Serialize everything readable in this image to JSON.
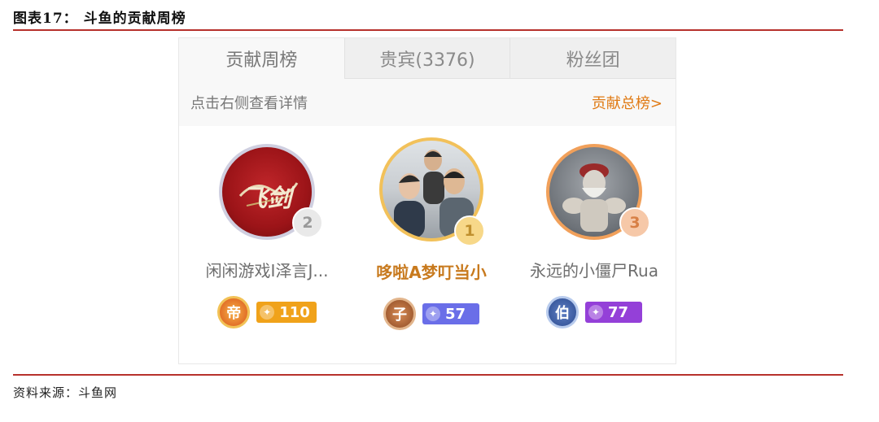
{
  "figure_title": "图表17： 斗鱼的贡献周榜",
  "source": "资料来源：斗鱼网",
  "tabs": [
    {
      "label": "贡献周榜",
      "active": true
    },
    {
      "label": "贵宾(3376)",
      "active": false
    },
    {
      "label": "粉丝团",
      "active": false
    }
  ],
  "infobar": {
    "hint": "点击右侧查看详情",
    "link": "贡献总榜>"
  },
  "ranking": [
    {
      "rank": "2",
      "name": "闲闲游戏I泽言J...",
      "avatar_text": "飞剑",
      "medal": "帝",
      "level": "110",
      "colors": {
        "ring": "#cfcfe0",
        "badge": "#b9b9b9",
        "level": "#f0a21a",
        "medal": "#e57b2a"
      }
    },
    {
      "rank": "1",
      "name": "哆啦A梦叮当小",
      "medal": "子",
      "level": "57",
      "colors": {
        "ring": "#f2c15a",
        "badge": "#f2c15a",
        "level": "#6a6ee8",
        "medal": "#b56b3a"
      }
    },
    {
      "rank": "3",
      "name": "永远的小僵尸Rua",
      "medal": "伯",
      "level": "77",
      "colors": {
        "ring": "#f1a05a",
        "badge": "#eea777",
        "level": "#9440d8",
        "medal": "#7d9ed8"
      }
    }
  ]
}
